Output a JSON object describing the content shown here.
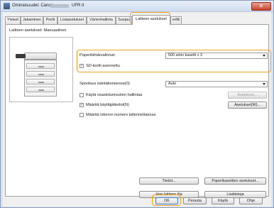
{
  "window": {
    "title_prefix": "Ominaisuudet: Canon",
    "title_model": "UFR II",
    "close_icon": "close-icon"
  },
  "tabs": [
    {
      "label": "Yleiset"
    },
    {
      "label": "Jakaminen"
    },
    {
      "label": "Portit"
    },
    {
      "label": "Lisäasetukset"
    },
    {
      "label": "Värienhallinta"
    },
    {
      "label": "Suojau"
    },
    {
      "label": "Laitteen asetukset",
      "active": true
    },
    {
      "label": "rofiili"
    }
  ],
  "panel": {
    "header": "Laitteen asetukset: Manuaalinen",
    "paper_source_label": "Paperilähdevalinnat:",
    "paper_source_value": "500 arkin kasetti x 3",
    "sd_card_label": "SD-kortti asennettu",
    "sd_card_checked": true,
    "spool_label": "Spoolaus isäntäkoneessa(0):",
    "spool_value": "Auto",
    "dept_id_label": "Käytä osastotunnusten hallintaa",
    "dept_id_checked": false,
    "dept_settings_button": "Asetukset...",
    "user_info_label": "Määritä käyttäjätiedot(N)",
    "user_info_checked": true,
    "user_settings_button": "Asetukset(W)...",
    "tray_number_label": "Määritä lokeron numero tallennettaessa",
    "tray_number_checked": false,
    "info_button": "Tiedot...",
    "paper_cassette_button": "Paperikasettien asetukset...",
    "get_device_status_button": "Hae laitteen tila",
    "about_button": "Lisätietoja"
  },
  "footer": {
    "ok": "OK",
    "cancel": "Peruuta",
    "apply": "Käytä",
    "help": "Ohje"
  },
  "colors": {
    "highlight": "#f0a12a",
    "default_button_border": "#3d7bc4"
  }
}
